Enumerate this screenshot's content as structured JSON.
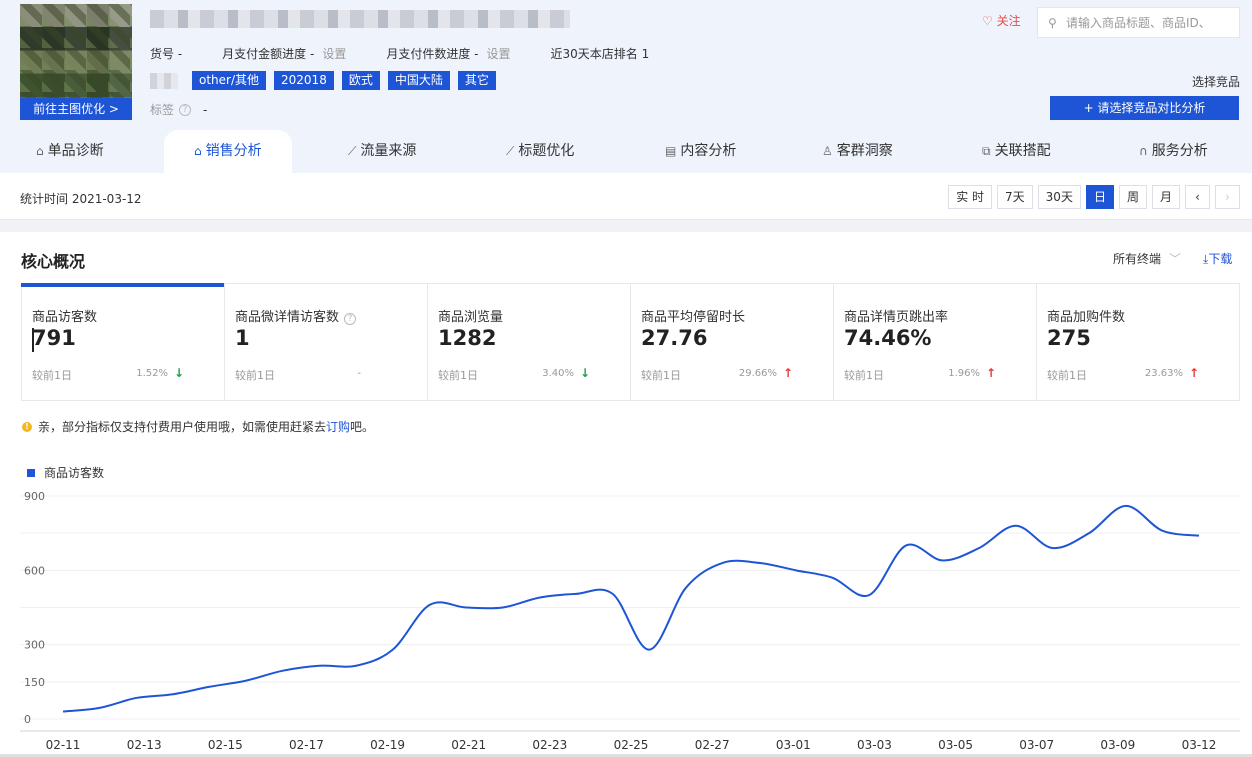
{
  "header": {
    "goto_label": "前往主图优化 >",
    "meta": [
      {
        "label": "货号 -",
        "action": ""
      },
      {
        "label": "月支付金额进度 -",
        "action": "设置"
      },
      {
        "label": "月支付件数进度 -",
        "action": "设置"
      },
      {
        "label": "近30天本店排名 1",
        "action": ""
      }
    ],
    "tags": [
      "other/其他",
      "202018",
      "欧式",
      "中国大陆",
      "其它"
    ],
    "label_title": "标签",
    "label_value": "-",
    "follow_label": "关注",
    "search_placeholder": "请输入商品标题、商品ID、",
    "choose_label": "选择竞品",
    "compare_button": "+ 请选择竞品对比分析"
  },
  "tabs": [
    {
      "label": "单品诊断",
      "icon": "bag-icon",
      "glyph": "⌂"
    },
    {
      "label": "销售分析",
      "icon": "bag-icon",
      "glyph": "⌂",
      "active": true
    },
    {
      "label": "流量来源",
      "icon": "trend-icon",
      "glyph": "⟋"
    },
    {
      "label": "标题优化",
      "icon": "trend-icon",
      "glyph": "⟋"
    },
    {
      "label": "内容分析",
      "icon": "doc-icon",
      "glyph": "▤"
    },
    {
      "label": "客群洞察",
      "icon": "users-icon",
      "glyph": "♙"
    },
    {
      "label": "关联搭配",
      "icon": "link-icon",
      "glyph": "⧉"
    },
    {
      "label": "服务分析",
      "icon": "headset-icon",
      "glyph": "∩"
    }
  ],
  "stat_time": "统计时间 2021-03-12",
  "time_buttons": [
    {
      "label": "实 时"
    },
    {
      "label": "7天"
    },
    {
      "label": "30天"
    },
    {
      "label": "日",
      "active": true
    },
    {
      "label": "周"
    },
    {
      "label": "月"
    },
    {
      "label": "‹"
    },
    {
      "label": "›",
      "disabled": true
    }
  ],
  "panel": {
    "title": "核心概况",
    "terminal": "所有终端",
    "download": "下载"
  },
  "kpis": [
    {
      "name": "商品访客数",
      "value": "791",
      "compare": "较前1日",
      "pct": "1.52%",
      "dir": "down",
      "active": true
    },
    {
      "name": "商品微详情访客数",
      "value": "1",
      "compare": "较前1日",
      "pct": "-",
      "dir": "",
      "help": true
    },
    {
      "name": "商品浏览量",
      "value": "1282",
      "compare": "较前1日",
      "pct": "3.40%",
      "dir": "down"
    },
    {
      "name": "商品平均停留时长",
      "value": "27.76",
      "compare": "较前1日",
      "pct": "29.66%",
      "dir": "up"
    },
    {
      "name": "商品详情页跳出率",
      "value": "74.46%",
      "compare": "较前1日",
      "pct": "1.96%",
      "dir": "up"
    },
    {
      "name": "商品加购件数",
      "value": "275",
      "compare": "较前1日",
      "pct": "23.63%",
      "dir": "up"
    }
  ],
  "notice": {
    "text": "亲，部分指标仅支持付费用户使用哦，如需使用赶紧去",
    "link": "订购",
    "suffix": "吧。"
  },
  "colors": {
    "accent": "#1d55d6",
    "up": "#e53b3b",
    "down": "#1ea14c"
  },
  "chart_data": {
    "type": "line",
    "series": [
      {
        "name": "商品访客数",
        "values": [
          30,
          45,
          85,
          100,
          130,
          155,
          195,
          215,
          215,
          280,
          460,
          450,
          450,
          490,
          505,
          505,
          280,
          530,
          630,
          630,
          600,
          570,
          500,
          700,
          640,
          690,
          780,
          690,
          750,
          860,
          760,
          740
        ]
      }
    ],
    "x": [
      "02-11",
      "02-12",
      "02-13",
      "02-14",
      "02-15",
      "02-16",
      "02-17",
      "02-18",
      "02-19",
      "02-20",
      "02-21",
      "02-22",
      "02-23",
      "02-24",
      "02-25",
      "02-26",
      "02-27",
      "02-28",
      "03-01",
      "03-02",
      "03-03",
      "03-04",
      "03-05",
      "03-06",
      "03-07",
      "03-08",
      "03-09",
      "03-10",
      "03-11",
      "03-12"
    ],
    "x_tick_labels": [
      "02-11",
      "02-13",
      "02-15",
      "02-17",
      "02-19",
      "02-21",
      "02-23",
      "02-25",
      "02-27",
      "03-01",
      "03-03",
      "03-05",
      "03-07",
      "03-09",
      "03-12"
    ],
    "y_ticks": [
      0,
      150,
      300,
      600,
      900
    ],
    "ylim": [
      0,
      900
    ],
    "grid": true
  }
}
